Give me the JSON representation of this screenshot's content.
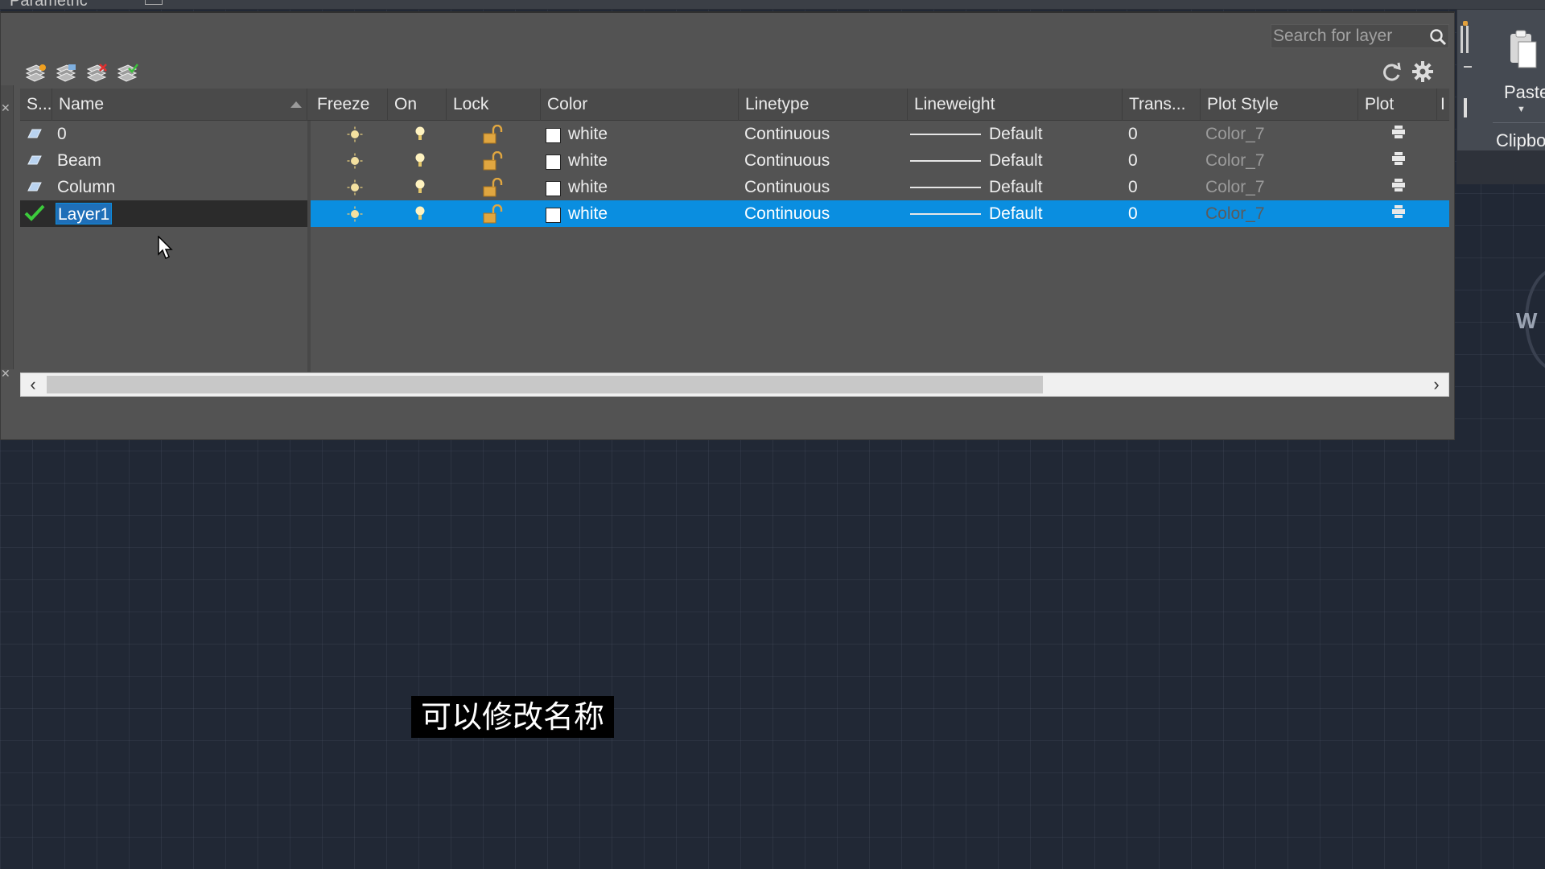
{
  "top_tab": {
    "label": "Parametric"
  },
  "search": {
    "placeholder": "Search for layer",
    "value": ""
  },
  "toolbar": {
    "tools": [
      {
        "icon": "new-layer-icon"
      },
      {
        "icon": "new-layer-vp-frozen-icon"
      },
      {
        "icon": "delete-layer-icon"
      },
      {
        "icon": "set-current-layer-icon"
      }
    ],
    "refresh_icon": "refresh-icon",
    "settings_icon": "gear-icon"
  },
  "columns": [
    "S...",
    "Name",
    "Freeze",
    "On",
    "Lock",
    "Color",
    "Linetype",
    "Lineweight",
    "Trans...",
    "Plot Style",
    "Plot",
    "I"
  ],
  "layers": [
    {
      "name": "0",
      "status": "layer",
      "color": "white",
      "linetype": "Continuous",
      "lineweight": "Default",
      "transparency": "0",
      "plot_style": "Color_7",
      "selected": false
    },
    {
      "name": "Beam",
      "status": "layer",
      "color": "white",
      "linetype": "Continuous",
      "lineweight": "Default",
      "transparency": "0",
      "plot_style": "Color_7",
      "selected": false
    },
    {
      "name": "Column",
      "status": "layer",
      "color": "white",
      "linetype": "Continuous",
      "lineweight": "Default",
      "transparency": "0",
      "plot_style": "Color_7",
      "selected": false
    },
    {
      "name": "Layer1",
      "status": "current",
      "color": "white",
      "linetype": "Continuous",
      "lineweight": "Default",
      "transparency": "0",
      "plot_style": "Color_7",
      "selected": true
    }
  ],
  "ribbon": {
    "paste_label": "Paste",
    "clipboard_label": "Clipbo",
    "partial_letter": "W"
  },
  "subtitle": "可以修改名称",
  "colors": {
    "selection": "#0a8ee0",
    "panel": "#535353",
    "canvas": "#212835",
    "layer_color_swatch": "#ffffff"
  }
}
